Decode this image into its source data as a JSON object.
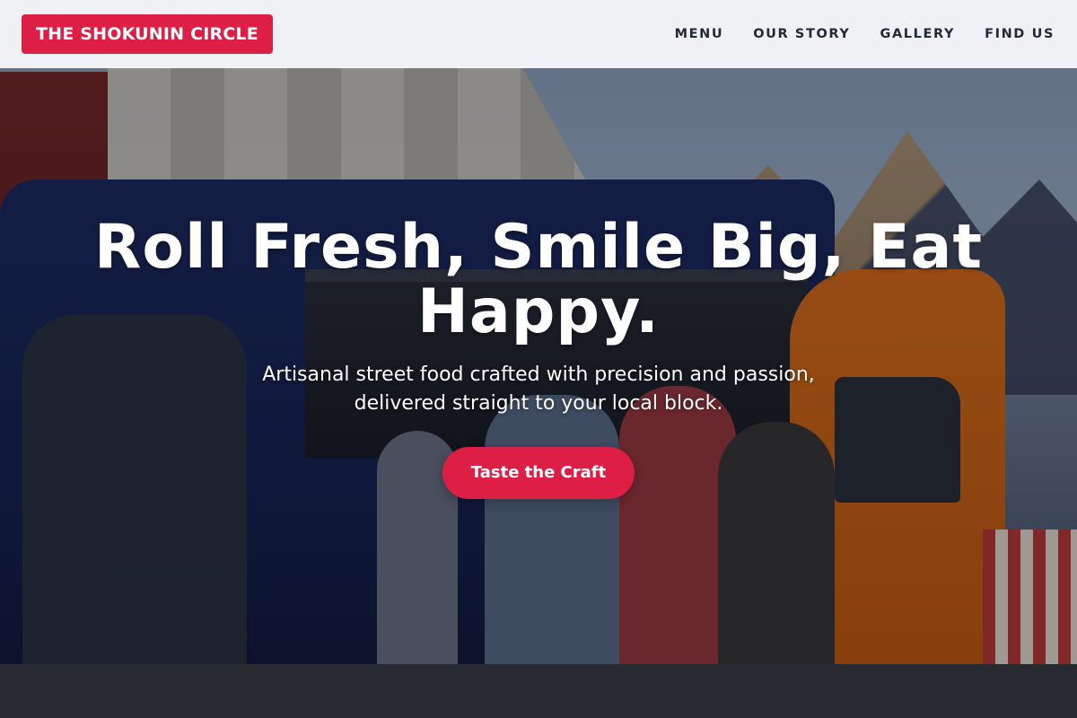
{
  "navbar": {
    "brand": "THE SHOKUNIN CIRCLE",
    "links": [
      {
        "label": "MENU"
      },
      {
        "label": "OUR STORY"
      },
      {
        "label": "GALLERY"
      },
      {
        "label": "FIND US"
      }
    ]
  },
  "hero": {
    "headline": "Roll Fresh, Smile Big, Eat Happy.",
    "subheadline": "Artisanal street food crafted with precision and passion, delivered straight to your local block.",
    "cta_label": "Taste the Craft",
    "background_image": "food-truck-crowd-photo"
  },
  "colors": {
    "accent": "#dd1f45",
    "nav_text": "#222a3a",
    "nav_bg": "#f5f6f8"
  }
}
